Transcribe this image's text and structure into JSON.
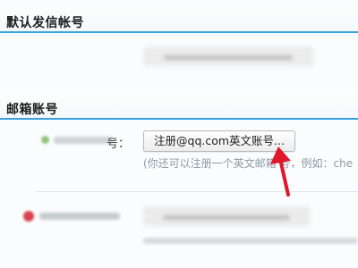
{
  "sections": {
    "default_sender": {
      "title": "默认发信帐号"
    },
    "mailbox_account": {
      "title": "邮箱账号"
    }
  },
  "rows": {
    "qq_row": {
      "colon": "号："
    },
    "third_row": {
      "colon": ""
    }
  },
  "register_button": {
    "label": "注册@qq.com英文账号..."
  },
  "hint_text": "(你还可以注册一个英文邮箱 号，例如：che",
  "colors": {
    "accent_line": "#3aa0dc",
    "arrow": "#e0162b",
    "hint": "#8e9aa4"
  },
  "annotation": {
    "arrow_icon": "red-arrow-icon"
  }
}
